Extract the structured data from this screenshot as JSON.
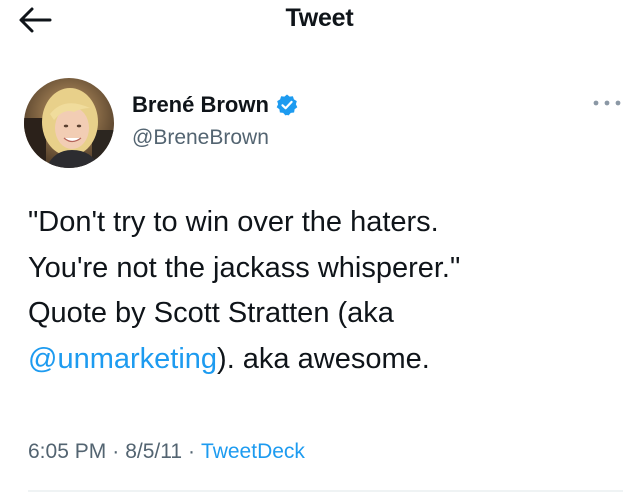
{
  "header": {
    "title": "Tweet",
    "back_icon": "arrow-left-icon"
  },
  "author": {
    "display_name": "Brené Brown",
    "handle": "@BreneBrown",
    "verified_icon": "verified-badge-icon",
    "more_icon": "more-horizontal-icon"
  },
  "tweet": {
    "text_before": "\"Don't try to win over the haters.\nYou're not the jackass whisperer.\"\nQuote by Scott Stratten (aka\n",
    "mention": "@unmarketing",
    "text_after": "). aka awesome."
  },
  "meta": {
    "time": "6:05 PM",
    "separator": "·",
    "date": "8/5/11",
    "source": "TweetDeck"
  },
  "colors": {
    "accent": "#1d9bf0",
    "text": "#0f1419",
    "secondary": "#536471"
  }
}
